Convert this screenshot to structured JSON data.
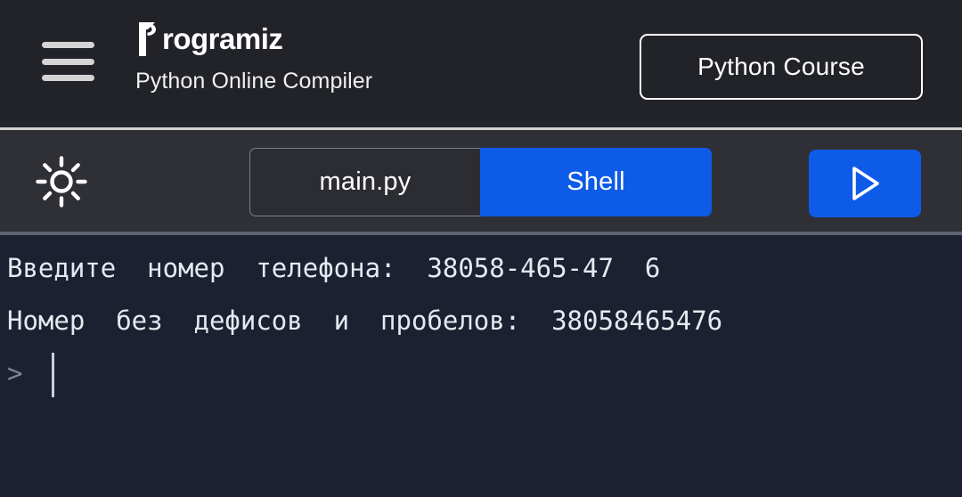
{
  "header": {
    "menu_icon": "hamburger-menu-icon",
    "logo_mark": "programiz-p-logo-icon",
    "logo_text": "rogramiz",
    "logo_full": "Programiz",
    "subtitle": "Python Online Compiler",
    "course_button": "Python Course",
    "background_color": "#212329"
  },
  "toolbar": {
    "theme_icon": "sun-brightness-icon",
    "tabs": [
      {
        "label": "main.py",
        "active": false
      },
      {
        "label": "Shell",
        "active": true
      }
    ],
    "run_icon": "play-triangle-icon",
    "accent_color": "#0e5be8",
    "background_color": "#2e3036"
  },
  "console": {
    "background_color": "#1b2130",
    "text_color": "#e6e9ef",
    "prompt_color": "#7d8596",
    "lines": [
      "Введите  номер  телефона:  38058-465-47  6",
      "Номер  без  дефисов  и  пробелов:  38058465476"
    ],
    "prompt_symbol": ">",
    "input_value": ""
  }
}
